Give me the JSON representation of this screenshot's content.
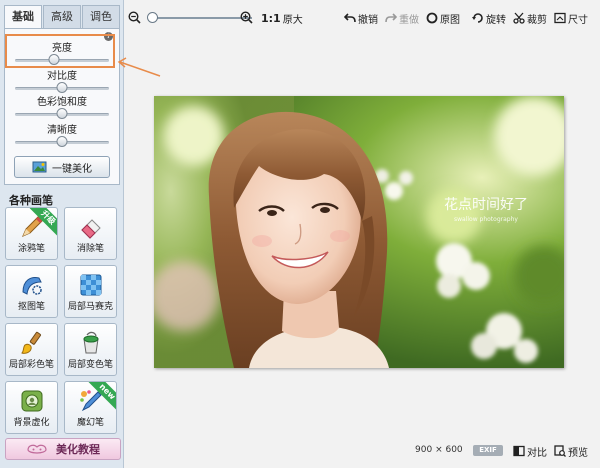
{
  "tabs": [
    {
      "label": "基础",
      "active": true
    },
    {
      "label": "高级",
      "active": false
    },
    {
      "label": "调色",
      "active": false
    }
  ],
  "adjust": {
    "sliders": [
      {
        "label": "亮度",
        "value_fraction": 0.42
      },
      {
        "label": "对比度",
        "value_fraction": 0.5
      },
      {
        "label": "色彩饱和度",
        "value_fraction": 0.5
      },
      {
        "label": "清晰度",
        "value_fraction": 0.5
      }
    ],
    "info_icon_glyph": "i",
    "one_click_label": "一键美化"
  },
  "brushes": {
    "title": "各种画笔",
    "items": [
      {
        "label": "涂鸦笔",
        "badge": "升级",
        "icon": "pencil-icon"
      },
      {
        "label": "消除笔",
        "badge": "",
        "icon": "eraser-icon"
      },
      {
        "label": "抠图笔",
        "badge": "",
        "icon": "cutout-pen-icon"
      },
      {
        "label": "局部马赛克",
        "badge": "",
        "icon": "mosaic-icon"
      },
      {
        "label": "局部彩色笔",
        "badge": "",
        "icon": "color-brush-icon"
      },
      {
        "label": "局部变色笔",
        "badge": "",
        "icon": "recolor-bucket-icon"
      },
      {
        "label": "背景虚化",
        "badge": "",
        "icon": "blur-background-icon"
      },
      {
        "label": "魔幻笔",
        "badge": "new",
        "icon": "magic-pen-icon"
      }
    ]
  },
  "tutorial_label": "美化教程",
  "toolbar": {
    "zoom_level_fraction": 0.0,
    "actual_size_ratio": "1:1",
    "actual_size_label": "原大",
    "undo": "撤销",
    "redo": "重做",
    "original": "原图",
    "rotate": "旋转",
    "crop": "裁剪",
    "size": "尺寸"
  },
  "photo": {
    "watermark_title": "花点时间好了",
    "watermark_sub": "swallow photography"
  },
  "status": {
    "width": "900",
    "times": "×",
    "height": "600",
    "exif": "EXIF",
    "compare": "对比",
    "preview": "预览"
  },
  "colors": {
    "accent_orange": "#e88b4a",
    "panel_bg": "#dde6ef",
    "badge_green": "#34a853"
  }
}
